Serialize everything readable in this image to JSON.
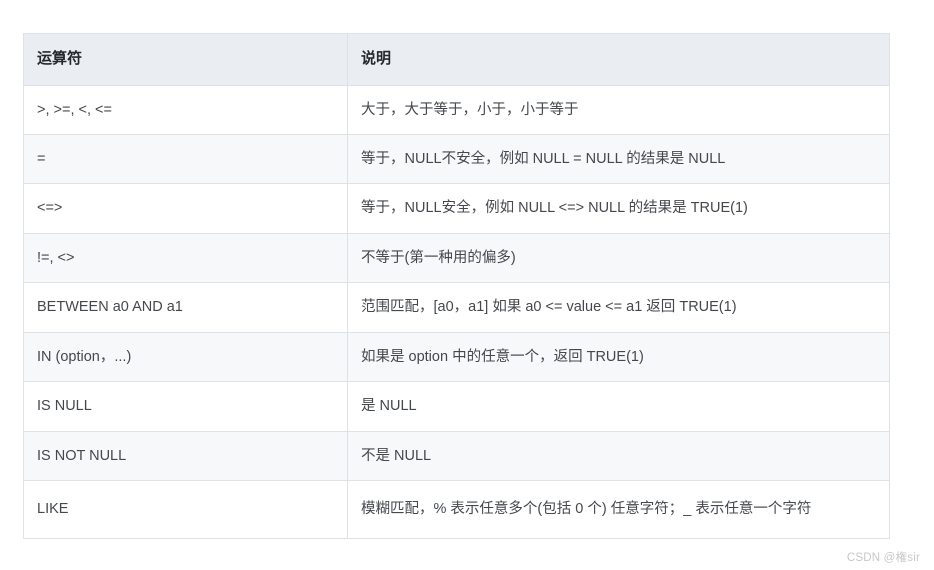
{
  "table": {
    "headers": {
      "operator": "运算符",
      "description": "说明"
    },
    "rows": [
      {
        "operator": ">,  >=,  <,  <=",
        "description": "大于，大于等于，小于，小于等于"
      },
      {
        "operator": "=",
        "description": "等于，NULL不安全，例如 NULL = NULL 的结果是 NULL"
      },
      {
        "operator": "<=>",
        "description": "等于，NULL安全，例如 NULL <=> NULL 的结果是 TRUE(1)"
      },
      {
        "operator": "!=,  <>",
        "description": "不等于(第一种用的偏多)"
      },
      {
        "operator": "BETWEEN a0 AND a1",
        "description": "范围匹配，[a0，a1] 如果 a0 <= value <= a1 返回 TRUE(1)"
      },
      {
        "operator": "IN (option，...)",
        "description": "如果是 option 中的任意一个，返回 TRUE(1)"
      },
      {
        "operator": "IS NULL",
        "description": "是 NULL"
      },
      {
        "operator": "IS NOT NULL",
        "description": "不是 NULL"
      },
      {
        "operator": "LIKE",
        "description": "模糊匹配，% 表示任意多个(包括 0 个) 任意字符；_ 表示任意一个字符"
      }
    ]
  },
  "watermark": {
    "text": "CSDN @権sir"
  },
  "colors": {
    "header_background": "#eaeef2",
    "border": "#dfe2e5",
    "row_alt_background": "#f6f8fa",
    "text": "#44484d",
    "header_text": "#24292e",
    "watermark_text": "#c8c8c8"
  }
}
